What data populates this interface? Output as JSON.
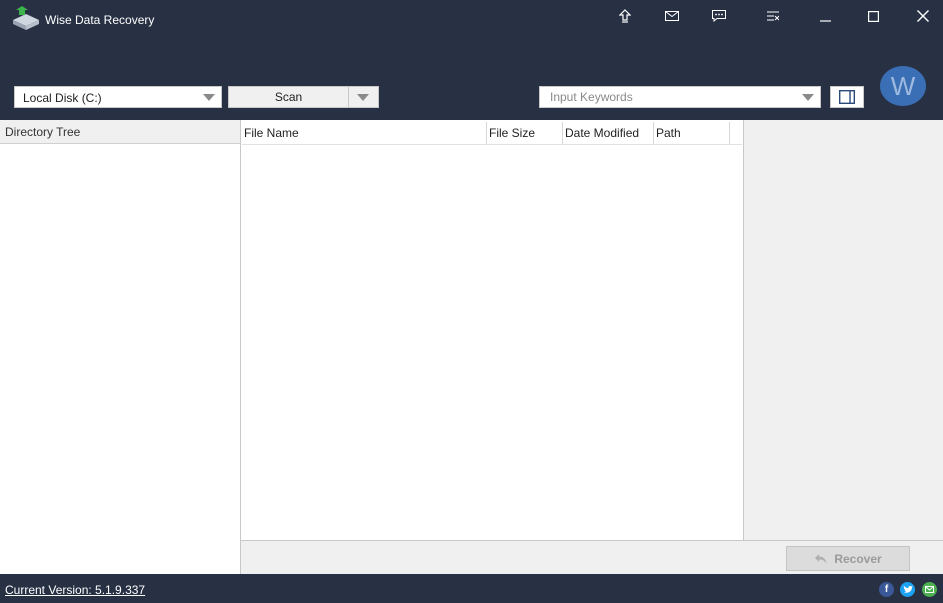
{
  "app": {
    "title": "Wise Data Recovery"
  },
  "toolbar": {
    "drive_selected": "Local Disk (C:)",
    "scan_label": "Scan",
    "keywords_placeholder": "Input Keywords",
    "avatar_letter": "W"
  },
  "directory": {
    "header": "Directory Tree"
  },
  "files": {
    "columns": [
      "File Name",
      "File Size",
      "Date Modified",
      "Path"
    ]
  },
  "actions": {
    "recover_label": "Recover"
  },
  "footer": {
    "version_text": "Current Version: 5.1.9.337"
  },
  "colors": {
    "header_bg": "#283144",
    "panel_bg": "#f0f0f0",
    "avatar_bg": "#3a6fb5",
    "facebook": "#3b5998",
    "twitter": "#1da1f2",
    "email": "#4caf50"
  }
}
